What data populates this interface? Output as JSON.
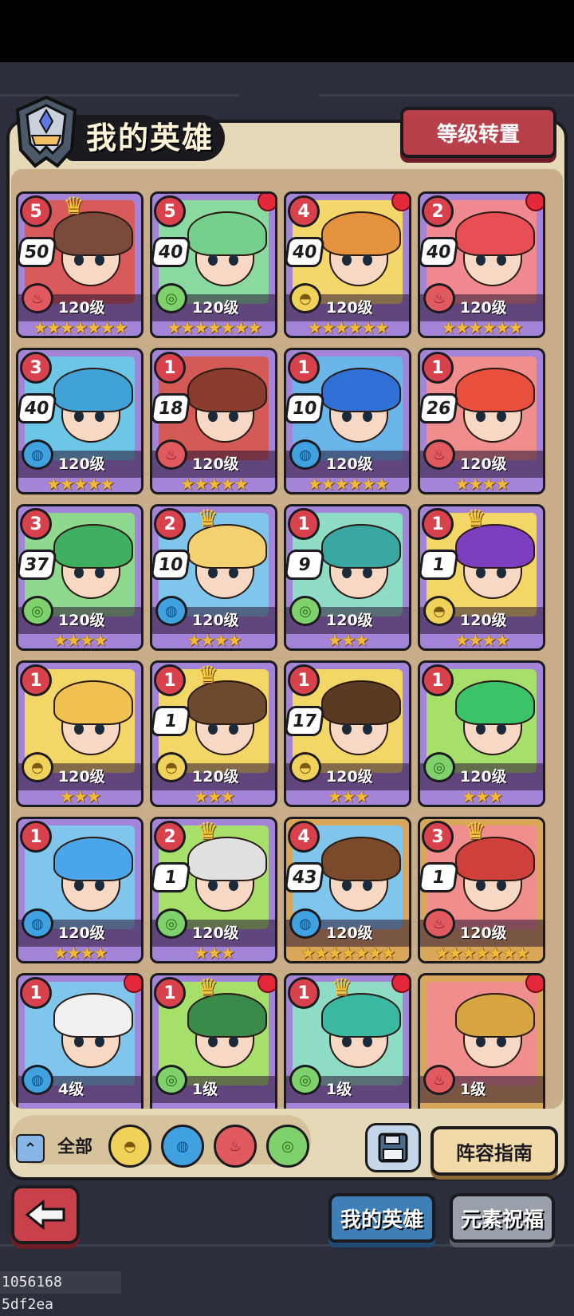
{
  "header": {
    "title": "我的英雄",
    "reset_button": "等级转置"
  },
  "colors": {
    "panel_bg": "#e6d9b7",
    "card_purple": "#a484d8",
    "card_gold": "#d9a75a",
    "active_tab": "#3e7fb8",
    "notify_dot": "#e5283a"
  },
  "heroes": [
    {
      "rank": "5",
      "stage": "50",
      "level_label": "120级",
      "element": "fire",
      "stars": "★★★★★★★",
      "crown": true,
      "notify": false,
      "frame": "purple",
      "hair_color": "#7a4b3a",
      "portrait_bg": "#d85a5a"
    },
    {
      "rank": "5",
      "stage": "40",
      "level_label": "120级",
      "element": "wind",
      "stars": "★★★★★★★",
      "crown": false,
      "notify": true,
      "frame": "purple",
      "hair_color": "#74d08a",
      "portrait_bg": "#8ad9a0"
    },
    {
      "rank": "4",
      "stage": "40",
      "level_label": "120级",
      "element": "earth",
      "stars": "★★★★★★",
      "crown": false,
      "notify": true,
      "frame": "purple",
      "hair_color": "#e5923e",
      "portrait_bg": "#f3d76b"
    },
    {
      "rank": "2",
      "stage": "40",
      "level_label": "120级",
      "element": "fire",
      "stars": "★★★★★★",
      "crown": false,
      "notify": true,
      "frame": "purple",
      "hair_color": "#e84f55",
      "portrait_bg": "#f08a90"
    },
    {
      "rank": "3",
      "stage": "40",
      "level_label": "120级",
      "element": "water",
      "stars": "★★★★★",
      "crown": false,
      "notify": false,
      "frame": "purple",
      "hair_color": "#3fa1d6",
      "portrait_bg": "#6cc7e6"
    },
    {
      "rank": "1",
      "stage": "18",
      "level_label": "120级",
      "element": "fire",
      "stars": "★★★★★",
      "crown": false,
      "notify": false,
      "frame": "purple",
      "hair_color": "#8a3d2e",
      "portrait_bg": "#d35a55"
    },
    {
      "rank": "1",
      "stage": "10",
      "level_label": "120级",
      "element": "water",
      "stars": "★★★★★★",
      "crown": false,
      "notify": false,
      "frame": "purple",
      "hair_color": "#2f6fd6",
      "portrait_bg": "#6ab6ea"
    },
    {
      "rank": "1",
      "stage": "26",
      "level_label": "120级",
      "element": "fire",
      "stars": "★★★★",
      "crown": false,
      "notify": false,
      "frame": "purple",
      "hair_color": "#e84f3d",
      "portrait_bg": "#ef8e8c"
    },
    {
      "rank": "3",
      "stage": "37",
      "level_label": "120级",
      "element": "wind",
      "stars": "★★★★",
      "crown": false,
      "notify": false,
      "frame": "purple",
      "hair_color": "#3fb060",
      "portrait_bg": "#8fd98f"
    },
    {
      "rank": "2",
      "stage": "10",
      "level_label": "120级",
      "element": "water",
      "stars": "★★★★",
      "crown": true,
      "notify": false,
      "frame": "purple",
      "hair_color": "#f3d070",
      "portrait_bg": "#7fc5ec"
    },
    {
      "rank": "1",
      "stage": "9",
      "level_label": "120级",
      "element": "wind",
      "stars": "★★★",
      "crown": false,
      "notify": false,
      "frame": "purple",
      "hair_color": "#3aa7a2",
      "portrait_bg": "#8fdcc6"
    },
    {
      "rank": "1",
      "stage": "1",
      "level_label": "120级",
      "element": "earth",
      "stars": "★★★★",
      "crown": true,
      "notify": false,
      "frame": "purple",
      "hair_color": "#7d3fc0",
      "portrait_bg": "#f3d766"
    },
    {
      "rank": "1",
      "stage": "",
      "level_label": "120级",
      "element": "earth",
      "stars": "★★★",
      "crown": false,
      "notify": false,
      "frame": "purple",
      "hair_color": "#f0c050",
      "portrait_bg": "#f3d766"
    },
    {
      "rank": "1",
      "stage": "1",
      "level_label": "120级",
      "element": "earth",
      "stars": "★★★",
      "crown": true,
      "notify": false,
      "frame": "purple",
      "hair_color": "#6d4a2e",
      "portrait_bg": "#f3d766"
    },
    {
      "rank": "1",
      "stage": "17",
      "level_label": "120级",
      "element": "earth",
      "stars": "★★★",
      "crown": false,
      "notify": false,
      "frame": "purple",
      "hair_color": "#5a3a22",
      "portrait_bg": "#f3d766"
    },
    {
      "rank": "1",
      "stage": "",
      "level_label": "120级",
      "element": "wind",
      "stars": "★★★",
      "crown": false,
      "notify": false,
      "frame": "purple",
      "hair_color": "#3cc36a",
      "portrait_bg": "#a6e06a"
    },
    {
      "rank": "1",
      "stage": "",
      "level_label": "120级",
      "element": "water",
      "stars": "★★★★",
      "crown": false,
      "notify": false,
      "frame": "purple",
      "hair_color": "#4aa6e8",
      "portrait_bg": "#7fc5ec"
    },
    {
      "rank": "2",
      "stage": "1",
      "level_label": "120级",
      "element": "wind",
      "stars": "★★★",
      "crown": true,
      "notify": false,
      "frame": "purple",
      "hair_color": "#e0e0e0",
      "portrait_bg": "#a6e06a"
    },
    {
      "rank": "4",
      "stage": "43",
      "level_label": "120级",
      "element": "water",
      "stars": "★★★★★★★",
      "crown": false,
      "notify": false,
      "frame": "gold",
      "hair_color": "#7a4a2a",
      "portrait_bg": "#7fc5ec"
    },
    {
      "rank": "3",
      "stage": "1",
      "level_label": "120级",
      "element": "fire",
      "stars": "★★★★★★★",
      "crown": true,
      "notify": false,
      "frame": "gold",
      "hair_color": "#d0403a",
      "portrait_bg": "#ef8e8c"
    },
    {
      "rank": "1",
      "stage": "",
      "level_label": "4级",
      "element": "water",
      "stars": "",
      "crown": false,
      "notify": true,
      "frame": "purple",
      "hair_color": "#f0f0f0",
      "portrait_bg": "#7fc5ec"
    },
    {
      "rank": "1",
      "stage": "",
      "level_label": "1级",
      "element": "wind",
      "stars": "",
      "crown": true,
      "notify": true,
      "frame": "purple",
      "hair_color": "#3a8a4a",
      "portrait_bg": "#a6e06a"
    },
    {
      "rank": "1",
      "stage": "",
      "level_label": "1级",
      "element": "wind",
      "stars": "",
      "crown": true,
      "notify": true,
      "frame": "purple",
      "hair_color": "#3ab8a2",
      "portrait_bg": "#8fdcc6"
    },
    {
      "rank": "",
      "stage": "",
      "level_label": "1级",
      "element": "fire",
      "stars": "",
      "crown": false,
      "notify": true,
      "frame": "gold",
      "hair_color": "#d7a640",
      "portrait_bg": "#ef8e8c"
    }
  ],
  "filters": {
    "all_label": "全部",
    "elements": [
      "earth",
      "water",
      "fire",
      "wind"
    ]
  },
  "actions": {
    "guide_button": "阵容指南"
  },
  "tabs": {
    "my_heroes": "我的英雄",
    "element_blessing": "元素祝福"
  },
  "footer": {
    "build_id": "1056168 5df2ea"
  }
}
